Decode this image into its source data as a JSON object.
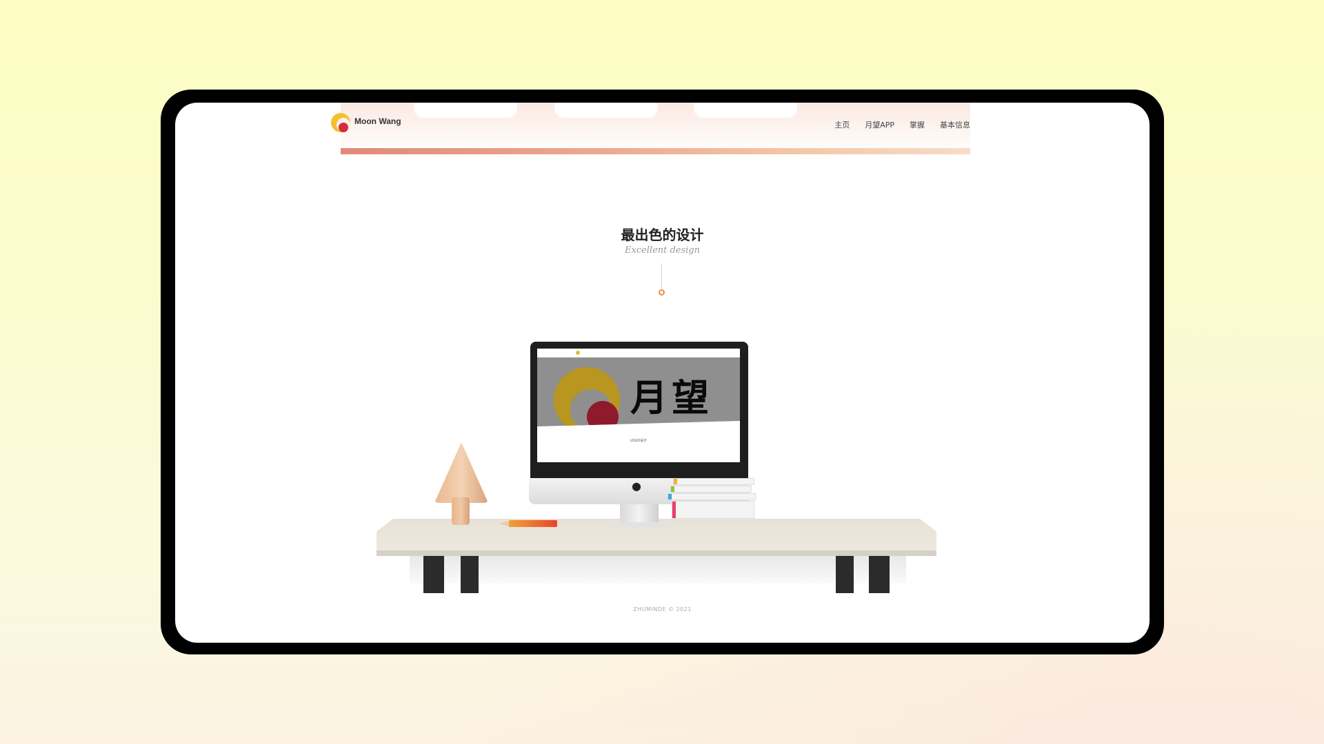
{
  "header": {
    "logo_text": "Moon Wang",
    "nav": [
      "主页",
      "月望APP",
      "掌握",
      "基本信息"
    ]
  },
  "section": {
    "title": "最出色的设计",
    "subtitle": "Excellent design"
  },
  "mockup": {
    "hero_text": "月望",
    "logo_label": "LOGO设计"
  },
  "footer": {
    "copyright": "ZHUMINDE © 2021"
  },
  "colors": {
    "accent_orange": "#f08a3e",
    "logo_yellow": "#f2c12e",
    "logo_red": "#d62b3c"
  }
}
